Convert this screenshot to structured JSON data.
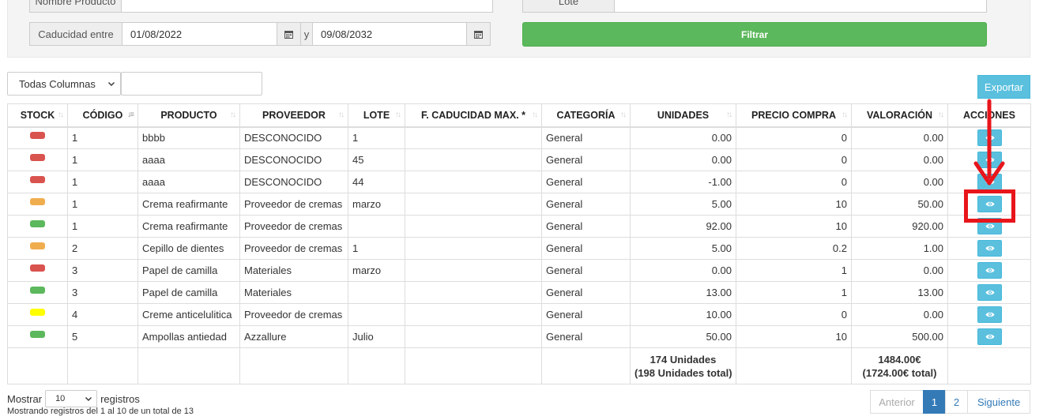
{
  "filters": {
    "nombre_producto_label": "Nombre Producto",
    "lote_label": "Lote",
    "caducidad_label": "Caducidad entre",
    "fecha_desde": "01/08/2022",
    "separator": "y",
    "fecha_hasta": "09/08/2032",
    "filtrar_label": "Filtrar"
  },
  "search": {
    "column_select": "Todas Columnas",
    "export_label": "Exportar"
  },
  "table": {
    "headers": {
      "stock": "STOCK",
      "codigo": "CÓDIGO",
      "producto": "PRODUCTO",
      "proveedor": "PROVEEDOR",
      "lote": "LOTE",
      "caducidad": "F. CADUCIDAD MAX. *",
      "categoria": "CATEGORÍA",
      "unidades": "UNIDADES",
      "precio": "PRECIO COMPRA",
      "valoracion": "VALORACIÓN",
      "acciones": "ACCIONES"
    },
    "rows": [
      {
        "stock_color": "#d9534f",
        "codigo": "1",
        "producto": "bbbb",
        "proveedor": "DESCONOCIDO",
        "lote": "1",
        "caducidad": "",
        "categoria": "General",
        "unidades": "0.00",
        "precio": "0",
        "valoracion": "0.00"
      },
      {
        "stock_color": "#d9534f",
        "codigo": "1",
        "producto": "aaaa",
        "proveedor": "DESCONOCIDO",
        "lote": "45",
        "caducidad": "",
        "categoria": "General",
        "unidades": "0.00",
        "precio": "0",
        "valoracion": "0.00"
      },
      {
        "stock_color": "#d9534f",
        "codigo": "1",
        "producto": "aaaa",
        "proveedor": "DESCONOCIDO",
        "lote": "44",
        "caducidad": "",
        "categoria": "General",
        "unidades": "-1.00",
        "precio": "0",
        "valoracion": "0.00"
      },
      {
        "stock_color": "#f0ad4e",
        "codigo": "1",
        "producto": "Crema reafirmante",
        "proveedor": "Proveedor de cremas",
        "lote": "marzo",
        "caducidad": "",
        "categoria": "General",
        "unidades": "5.00",
        "precio": "10",
        "valoracion": "50.00"
      },
      {
        "stock_color": "#5cb85c",
        "codigo": "1",
        "producto": "Crema reafirmante",
        "proveedor": "Proveedor de cremas",
        "lote": "",
        "caducidad": "",
        "categoria": "General",
        "unidades": "92.00",
        "precio": "10",
        "valoracion": "920.00"
      },
      {
        "stock_color": "#f0ad4e",
        "codigo": "2",
        "producto": "Cepillo de dientes",
        "proveedor": "Proveedor de cremas",
        "lote": "1",
        "caducidad": "",
        "categoria": "General",
        "unidades": "5.00",
        "precio": "0.2",
        "valoracion": "1.00"
      },
      {
        "stock_color": "#d9534f",
        "codigo": "3",
        "producto": "Papel de camilla",
        "proveedor": "Materiales",
        "lote": "marzo",
        "caducidad": "",
        "categoria": "General",
        "unidades": "0.00",
        "precio": "1",
        "valoracion": "0.00"
      },
      {
        "stock_color": "#5cb85c",
        "codigo": "3",
        "producto": "Papel de camilla",
        "proveedor": "Materiales",
        "lote": "",
        "caducidad": "",
        "categoria": "General",
        "unidades": "13.00",
        "precio": "1",
        "valoracion": "13.00"
      },
      {
        "stock_color": "#ffff00",
        "codigo": "4",
        "producto": "Creme anticelulitica",
        "proveedor": "Proveedor de cremas",
        "lote": "",
        "caducidad": "",
        "categoria": "General",
        "unidades": "10.00",
        "precio": "0",
        "valoracion": "0.00"
      },
      {
        "stock_color": "#5cb85c",
        "codigo": "5",
        "producto": "Ampollas antiedad",
        "proveedor": "Azzallure",
        "lote": "Julio",
        "caducidad": "",
        "categoria": "General",
        "unidades": "50.00",
        "precio": "10",
        "valoracion": "500.00"
      }
    ],
    "totals": {
      "unidades_line1": "174 Unidades",
      "unidades_line2": "(198 Unidades total)",
      "valoracion_line1": "1484.00€",
      "valoracion_line2": "(1724.00€ total)"
    }
  },
  "footer": {
    "mostrar": "Mostrar",
    "page_length": "10",
    "registros": "registros",
    "info": "Mostrando registros del 1 al 10 de un total de 13",
    "prev": "Anterior",
    "pages": [
      "1",
      "2"
    ],
    "next": "Siguiente"
  },
  "icons": {
    "calendar": "calendar-icon",
    "view": "eye-icon",
    "sort": "sort-icon"
  },
  "colors": {
    "filter_button": "#5cb85c",
    "export_button": "#5bc0de",
    "view_button": "#5bc0de",
    "annotation": "#e8151b",
    "pager_active": "#337ab7"
  }
}
